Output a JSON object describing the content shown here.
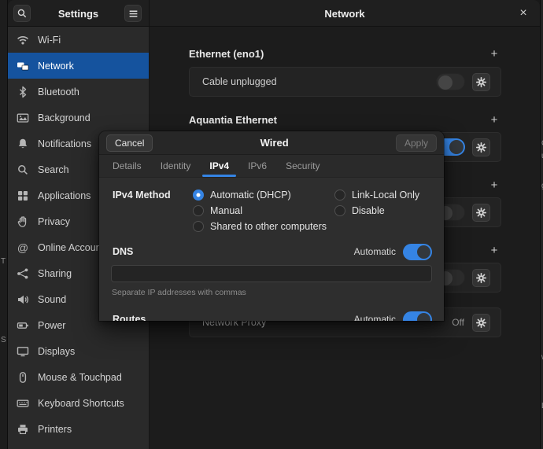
{
  "colors": {
    "accent": "#3584e4",
    "sidebar_selection": "#15539e"
  },
  "header": {
    "app_title": "Settings",
    "page_title": "Network",
    "close_glyph": "×"
  },
  "sidebar": {
    "items": [
      {
        "label": "Wi-Fi",
        "selected": false
      },
      {
        "label": "Network",
        "selected": true
      },
      {
        "label": "Bluetooth",
        "selected": false
      },
      {
        "label": "Background",
        "selected": false
      },
      {
        "label": "Notifications",
        "selected": false
      },
      {
        "label": "Search",
        "selected": false
      },
      {
        "label": "Applications",
        "selected": false
      },
      {
        "label": "Privacy",
        "selected": false
      },
      {
        "label": "Online Accounts",
        "selected": false
      },
      {
        "label": "Sharing",
        "selected": false
      },
      {
        "label": "Sound",
        "selected": false
      },
      {
        "label": "Power",
        "selected": false
      },
      {
        "label": "Displays",
        "selected": false
      },
      {
        "label": "Mouse & Touchpad",
        "selected": false
      },
      {
        "label": "Keyboard Shortcuts",
        "selected": false
      },
      {
        "label": "Printers",
        "selected": false
      }
    ]
  },
  "content": {
    "sections": [
      {
        "title": "Ethernet (eno1)",
        "add_label": "+",
        "row": {
          "label": "Cable unplugged",
          "toggle": "off"
        }
      },
      {
        "title": "Aquantia Ethernet",
        "add_label": "+",
        "row": {
          "label": "",
          "toggle": "on"
        }
      },
      {
        "title": "",
        "add_label": "+",
        "row": {
          "label": "",
          "toggle": "off"
        }
      },
      {
        "title": "",
        "add_label": "+",
        "row": {
          "label": "",
          "toggle": "off"
        }
      }
    ],
    "proxy_row": {
      "label": "Network Proxy",
      "value": "Off"
    }
  },
  "dialog": {
    "title": "Wired",
    "cancel_label": "Cancel",
    "apply_label": "Apply",
    "apply_enabled": false,
    "tabs": [
      {
        "label": "Details",
        "active": false
      },
      {
        "label": "Identity",
        "active": false
      },
      {
        "label": "IPv4",
        "active": true
      },
      {
        "label": "IPv6",
        "active": false
      },
      {
        "label": "Security",
        "active": false
      }
    ],
    "ipv4": {
      "method_label": "IPv4 Method",
      "methods_col1": [
        {
          "label": "Automatic (DHCP)",
          "selected": true
        },
        {
          "label": "Manual",
          "selected": false
        },
        {
          "label": "Shared to other computers",
          "selected": false
        }
      ],
      "methods_col2": [
        {
          "label": "Link-Local Only",
          "selected": false
        },
        {
          "label": "Disable",
          "selected": false
        }
      ],
      "dns_label": "DNS",
      "dns_automatic_label": "Automatic",
      "dns_toggle": "on",
      "dns_value": "",
      "dns_helper": "Separate IP addresses with commas",
      "routes_label": "Routes",
      "routes_automatic_label": "Automatic",
      "routes_toggle": "on"
    }
  },
  "edge_artifacts": {
    "left": [
      "T",
      "S"
    ],
    "right": [
      "C",
      "u",
      "g",
      "w",
      "L"
    ]
  }
}
